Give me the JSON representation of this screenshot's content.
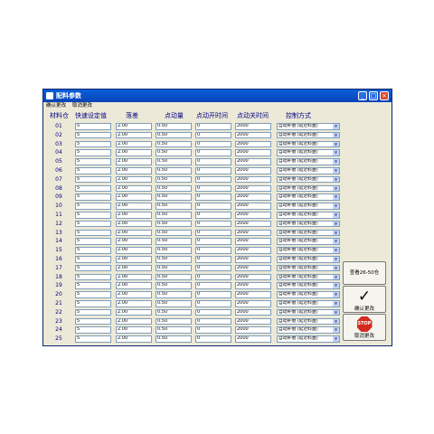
{
  "window": {
    "title": "配料参数"
  },
  "menu": {
    "confirm": "确认更改",
    "cancel": "取消更改"
  },
  "headers": [
    "材料仓",
    "快速设定值",
    "落差",
    "点动量",
    "点动开时间",
    "点动关时间",
    "控制方式"
  ],
  "rows": [
    {
      "bin": "01",
      "fast": "5",
      "drop": "2.00",
      "jog": "0.50",
      "on": "0",
      "off": "2000",
      "mode": "自动补偿 (延迟料盘)"
    },
    {
      "bin": "02",
      "fast": "5",
      "drop": "2.00",
      "jog": "0.50",
      "on": "0",
      "off": "2000",
      "mode": "自动补偿 (延迟料盘)"
    },
    {
      "bin": "03",
      "fast": "5",
      "drop": "2.00",
      "jog": "0.50",
      "on": "0",
      "off": "2000",
      "mode": "自动补偿 (延迟料盘)"
    },
    {
      "bin": "04",
      "fast": "5",
      "drop": "2.00",
      "jog": "0.50",
      "on": "0",
      "off": "2000",
      "mode": "自动补偿 (延迟料盘)"
    },
    {
      "bin": "05",
      "fast": "5",
      "drop": "2.00",
      "jog": "0.50",
      "on": "0",
      "off": "2000",
      "mode": "自动补偿 (延迟料盘)"
    },
    {
      "bin": "06",
      "fast": "5",
      "drop": "2.00",
      "jog": "0.50",
      "on": "0",
      "off": "2000",
      "mode": "自动补偿 (延迟料盘)"
    },
    {
      "bin": "07",
      "fast": "5",
      "drop": "2.00",
      "jog": "0.50",
      "on": "0",
      "off": "2000",
      "mode": "自动补偿 (延迟料盘)"
    },
    {
      "bin": "08",
      "fast": "5",
      "drop": "2.00",
      "jog": "0.50",
      "on": "0",
      "off": "2000",
      "mode": "自动补偿 (延迟料盘)"
    },
    {
      "bin": "09",
      "fast": "5",
      "drop": "2.00",
      "jog": "0.50",
      "on": "0",
      "off": "2000",
      "mode": "自动补偿 (延迟料盘)"
    },
    {
      "bin": "10",
      "fast": "5",
      "drop": "2.00",
      "jog": "0.50",
      "on": "0",
      "off": "2000",
      "mode": "自动补偿 (延迟料盘)"
    },
    {
      "bin": "11",
      "fast": "5",
      "drop": "2.00",
      "jog": "0.50",
      "on": "0",
      "off": "2000",
      "mode": "自动补偿 (延迟料盘)"
    },
    {
      "bin": "12",
      "fast": "5",
      "drop": "2.00",
      "jog": "0.50",
      "on": "0",
      "off": "2000",
      "mode": "自动补偿 (延迟料盘)"
    },
    {
      "bin": "13",
      "fast": "5",
      "drop": "2.00",
      "jog": "0.50",
      "on": "0",
      "off": "2000",
      "mode": "自动补偿 (延迟料盘)"
    },
    {
      "bin": "14",
      "fast": "5",
      "drop": "2.00",
      "jog": "0.50",
      "on": "0",
      "off": "2000",
      "mode": "自动补偿 (延迟料盘)"
    },
    {
      "bin": "15",
      "fast": "5",
      "drop": "2.00",
      "jog": "0.50",
      "on": "0",
      "off": "2000",
      "mode": "自动补偿 (延迟料盘)"
    },
    {
      "bin": "16",
      "fast": "5",
      "drop": "2.00",
      "jog": "0.50",
      "on": "0",
      "off": "2000",
      "mode": "自动补偿 (延迟料盘)"
    },
    {
      "bin": "17",
      "fast": "5",
      "drop": "2.00",
      "jog": "0.50",
      "on": "0",
      "off": "2000",
      "mode": "自动补偿 (延迟料盘)"
    },
    {
      "bin": "18",
      "fast": "5",
      "drop": "2.00",
      "jog": "0.50",
      "on": "0",
      "off": "2000",
      "mode": "自动补偿 (延迟料盘)"
    },
    {
      "bin": "19",
      "fast": "5",
      "drop": "2.00",
      "jog": "0.50",
      "on": "0",
      "off": "2000",
      "mode": "自动补偿 (延迟料盘)"
    },
    {
      "bin": "20",
      "fast": "5",
      "drop": "2.00",
      "jog": "0.50",
      "on": "0",
      "off": "2000",
      "mode": "自动补偿 (延迟料盘)"
    },
    {
      "bin": "21",
      "fast": "5",
      "drop": "2.00",
      "jog": "0.50",
      "on": "0",
      "off": "2000",
      "mode": "自动补偿 (延迟料盘)"
    },
    {
      "bin": "22",
      "fast": "5",
      "drop": "2.00",
      "jog": "0.50",
      "on": "0",
      "off": "2000",
      "mode": "自动补偿 (延迟料盘)"
    },
    {
      "bin": "23",
      "fast": "5",
      "drop": "2.00",
      "jog": "0.50",
      "on": "0",
      "off": "2000",
      "mode": "自动补偿 (延迟料盘)"
    },
    {
      "bin": "24",
      "fast": "5",
      "drop": "2.00",
      "jog": "0.50",
      "on": "0",
      "off": "2000",
      "mode": "自动补偿 (延迟料盘)"
    },
    {
      "bin": "25",
      "fast": "5",
      "drop": "2.00",
      "jog": "0.50",
      "on": "0",
      "off": "2000",
      "mode": "自动补偿 (延迟料盘)"
    }
  ],
  "buttons": {
    "view_more": "查看26-50仓",
    "confirm": "确认更改",
    "cancel": "取消更改",
    "stop_text": "STOP"
  },
  "icons": {
    "window": "app-icon",
    "minimize": "minimize-icon",
    "maximize": "maximize-icon",
    "close": "close-icon",
    "confirm": "checkmark-icon",
    "cancel": "stop-sign-icon",
    "dropdown": "chevron-down-icon"
  },
  "colors": {
    "titlebar": "#0a5fd8",
    "header_text": "#000080",
    "stop": "#d52a1e"
  }
}
